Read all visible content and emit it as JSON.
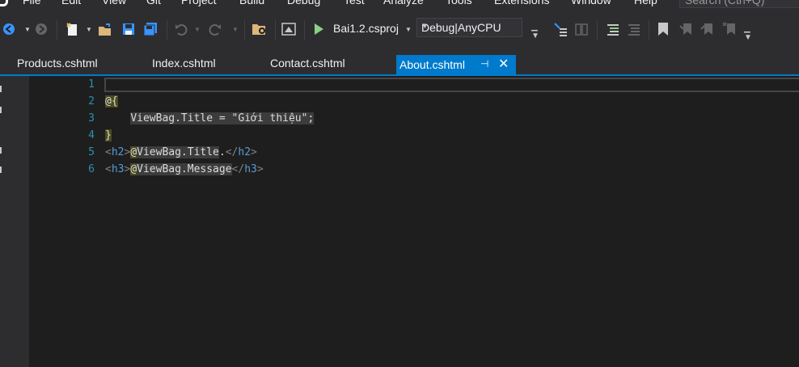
{
  "menu": {
    "items": [
      "File",
      "Edit",
      "View",
      "Git",
      "Project",
      "Build",
      "Debug",
      "Test",
      "Analyze",
      "Tools",
      "Extensions",
      "Window",
      "Help"
    ],
    "search_placeholder": "Search (Ctrl+Q)"
  },
  "toolbar": {
    "project": "Bai1.2.csproj",
    "config": "Debug|AnyCPU"
  },
  "tabs": [
    {
      "label": "Products.cshtml"
    },
    {
      "label": "Index.cshtml"
    },
    {
      "label": "Contact.cshtml"
    },
    {
      "label": "About.cshtml",
      "active": true
    }
  ],
  "editor": {
    "line_numbers": [
      "1",
      "2",
      "3",
      "4",
      "5",
      "6"
    ],
    "line2": {
      "at": "@{"
    },
    "line3": {
      "text": "ViewBag.Title = \"Giới thiệu\";"
    },
    "line4": {
      "brace": "}"
    },
    "line5": {
      "open_lt": "<",
      "open_name": "h2",
      "open_gt": ">",
      "razor": "@",
      "expr": "ViewBag.Title",
      "dot": ".",
      "close_lt": "</",
      "close_name": "h2",
      "close_gt": ">"
    },
    "line6": {
      "open_lt": "<",
      "open_name": "h3",
      "open_gt": ">",
      "razor": "@",
      "expr": "ViewBag.Message",
      "close_lt": "</",
      "close_name": "h3",
      "close_gt": ">"
    }
  },
  "colors": {
    "accent": "#007acc",
    "line_number": "#2b91af",
    "tag": "#569cd6",
    "razor_bg": "#4b4b1e"
  }
}
